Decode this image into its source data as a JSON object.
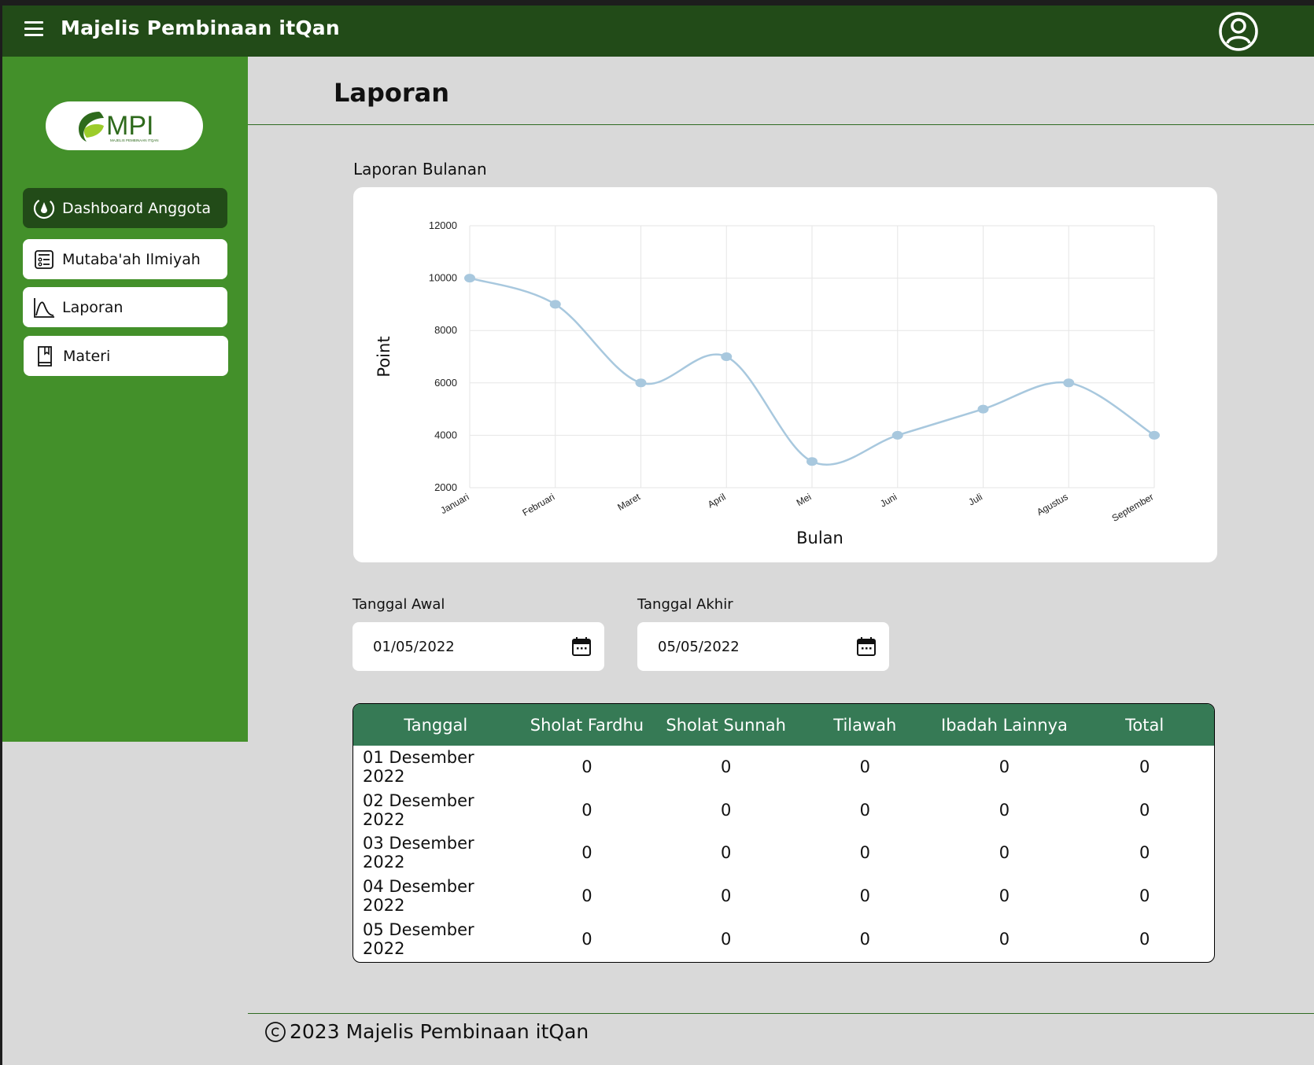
{
  "app": {
    "title": "Majelis Pembinaan itQan"
  },
  "sidebar": {
    "logo_text": "MPI",
    "logo_sub": "MAJELIS PEMBINAAN ITQAN",
    "items": [
      {
        "label": "Dashboard Anggota",
        "icon": "dashboard-icon",
        "active": true
      },
      {
        "label": "Mutaba'ah Ilmiyah",
        "icon": "checklist-icon",
        "active": false
      },
      {
        "label": "Laporan",
        "icon": "chart-line-icon",
        "active": false
      },
      {
        "label": "Materi",
        "icon": "book-icon",
        "active": false
      }
    ]
  },
  "main": {
    "page_title": "Laporan",
    "chart_section_label": "Laporan Bulanan",
    "date_start_label": "Tanggal Awal",
    "date_start_value": "01/05/2022",
    "date_end_label": "Tanggal Akhir",
    "date_end_value": "05/05/2022"
  },
  "chart_data": {
    "type": "line",
    "title": "",
    "xlabel": "Bulan",
    "ylabel": "Point",
    "categories": [
      "Januari",
      "Februari",
      "Maret",
      "April",
      "Mei",
      "Juni",
      "Juli",
      "Agustus",
      "September"
    ],
    "series": [
      {
        "values": [
          10000,
          9000,
          6000,
          7000,
          3000,
          4000,
          5000,
          6000,
          4000
        ]
      }
    ],
    "ylim": [
      2000,
      12000
    ],
    "yticks": [
      2000,
      4000,
      6000,
      8000,
      10000,
      12000
    ],
    "grid": true,
    "line_color": "#a8c8de"
  },
  "table": {
    "headers": [
      "Tanggal",
      "Sholat Fardhu",
      "Sholat Sunnah",
      "Tilawah",
      "Ibadah Lainnya",
      "Total"
    ],
    "rows": [
      [
        "01 Desember 2022",
        "0",
        "0",
        "0",
        "0",
        "0"
      ],
      [
        "02 Desember 2022",
        "0",
        "0",
        "0",
        "0",
        "0"
      ],
      [
        "03 Desember 2022",
        "0",
        "0",
        "0",
        "0",
        "0"
      ],
      [
        "04 Desember 2022",
        "0",
        "0",
        "0",
        "0",
        "0"
      ],
      [
        "05 Desember 2022",
        "0",
        "0",
        "0",
        "0",
        "0"
      ]
    ]
  },
  "footer": {
    "text": "2023 Majelis Pembinaan itQan"
  },
  "colors": {
    "topbar": "#224b18",
    "sidebar": "#43902a",
    "table_header": "#367a55"
  }
}
